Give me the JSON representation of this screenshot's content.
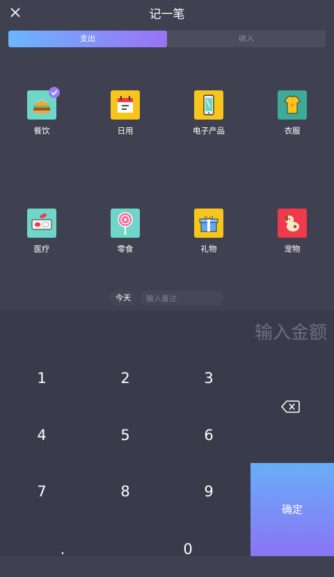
{
  "header": {
    "title": "记一笔"
  },
  "tabs": [
    {
      "label": "支出",
      "active": true
    },
    {
      "label": "收入",
      "active": false
    }
  ],
  "categories": [
    {
      "label": "餐饮",
      "icon": "burger-icon",
      "color": "#6fd6c9",
      "selected": true
    },
    {
      "label": "日用",
      "icon": "calendar-icon",
      "color": "#f8c61b",
      "selected": false
    },
    {
      "label": "电子产品",
      "icon": "phone-icon",
      "color": "#f8c61b",
      "selected": false
    },
    {
      "label": "衣服",
      "icon": "tshirt-icon",
      "color": "#3dab95",
      "selected": false
    },
    {
      "label": "医疗",
      "icon": "pill-icon",
      "color": "#6fd6c9",
      "selected": false
    },
    {
      "label": "零食",
      "icon": "lollipop-icon",
      "color": "#6fd6c9",
      "selected": false
    },
    {
      "label": "礼物",
      "icon": "gift-icon",
      "color": "#f8c61b",
      "selected": false
    },
    {
      "label": "宠物",
      "icon": "dog-icon",
      "color": "#f0394b",
      "selected": false
    }
  ],
  "pagination": {
    "count": 2,
    "current": 0
  },
  "entry": {
    "date_label": "今天",
    "note_placeholder": "输入备注"
  },
  "amount": {
    "placeholder": "输入金额"
  },
  "keypad": {
    "keys": [
      "1",
      "2",
      "3",
      "4",
      "5",
      "6",
      "7",
      "8",
      "9",
      ".",
      "0"
    ],
    "confirm_label": "确定",
    "backspace_icon": "backspace-icon"
  },
  "colors": {
    "accent_start": "#6ab6fb",
    "accent_end": "#9b72f5",
    "background": "#3f4151"
  }
}
